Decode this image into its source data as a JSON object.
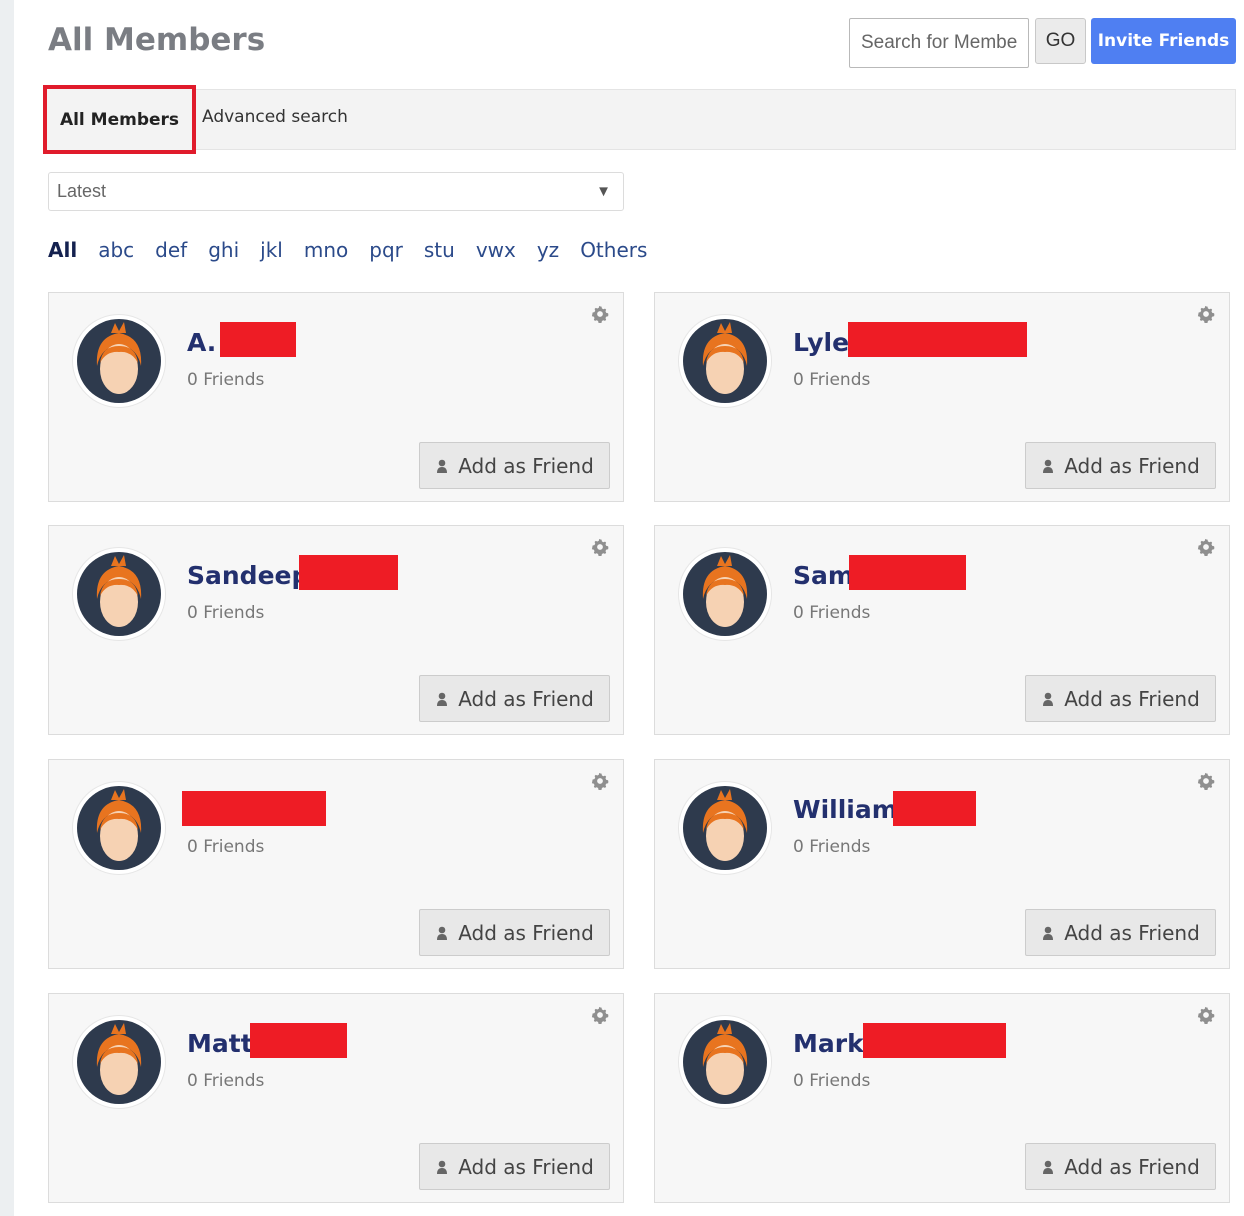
{
  "header": {
    "title": "All Members",
    "search_placeholder": "Search for Members",
    "go_label": "GO",
    "invite_label": "Invite Friends"
  },
  "tabs": [
    {
      "label": "All Members",
      "active": true
    },
    {
      "label": "Advanced search",
      "active": false
    }
  ],
  "sort": {
    "selected": "Latest"
  },
  "letters": [
    "All",
    "abc",
    "def",
    "ghi",
    "jkl",
    "mno",
    "pqr",
    "stu",
    "vwx",
    "yz",
    "Others"
  ],
  "members": [
    {
      "name": "A.",
      "friends": "0 Friends",
      "button": "Add as Friend"
    },
    {
      "name": "Lyle",
      "friends": "0 Friends",
      "button": "Add as Friend"
    },
    {
      "name": "Sandeep",
      "friends": "0 Friends",
      "button": "Add as Friend"
    },
    {
      "name": "Sam",
      "friends": "0 Friends",
      "button": "Add as Friend"
    },
    {
      "name": "",
      "friends": "0 Friends",
      "button": "Add as Friend"
    },
    {
      "name": "William",
      "friends": "0 Friends",
      "button": "Add as Friend"
    },
    {
      "name": "Matt",
      "friends": "0 Friends",
      "button": "Add as Friend"
    },
    {
      "name": "Mark",
      "friends": "0 Friends",
      "button": "Add as Friend"
    }
  ],
  "colors": {
    "accent": "#4f7ff2",
    "name_color": "#23306e",
    "redaction": "#ee1c25",
    "highlight_border": "#e01b2b"
  },
  "icons": {
    "settings": "gear-icon",
    "add_friend": "person-icon",
    "avatar": "avatar-icon",
    "sort_arrow": "caret-down-icon"
  }
}
